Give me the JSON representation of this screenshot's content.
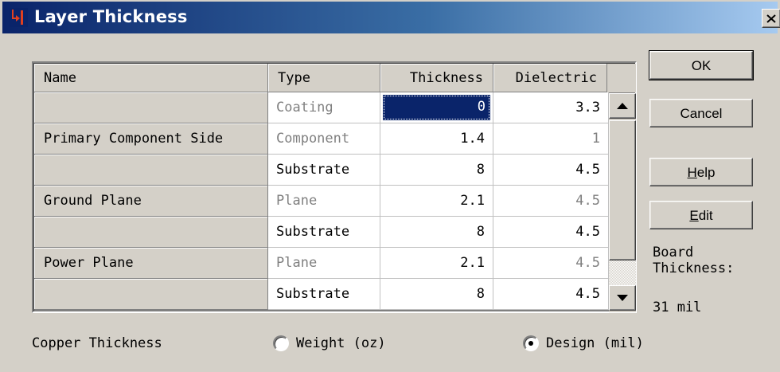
{
  "window": {
    "title": "Layer Thickness"
  },
  "grid": {
    "columns": [
      "Name",
      "Type",
      "Thickness",
      "Dielectric"
    ],
    "rows": [
      {
        "name": "",
        "type": "Coating",
        "thickness": "0",
        "dielectric": "3.3"
      },
      {
        "name": "Primary Component Side",
        "type": "Component",
        "thickness": "1.4",
        "dielectric": "1"
      },
      {
        "name": "",
        "type": "Substrate",
        "thickness": "8",
        "dielectric": "4.5"
      },
      {
        "name": "Ground Plane",
        "type": "Plane",
        "thickness": "2.1",
        "dielectric": "4.5"
      },
      {
        "name": "",
        "type": "Substrate",
        "thickness": "8",
        "dielectric": "4.5"
      },
      {
        "name": "Power Plane",
        "type": "Plane",
        "thickness": "2.1",
        "dielectric": "4.5"
      },
      {
        "name": "",
        "type": "Substrate",
        "thickness": "8",
        "dielectric": "4.5"
      }
    ]
  },
  "buttons": {
    "ok": "OK",
    "cancel": "Cancel",
    "help": {
      "underline": "H",
      "rest": "elp"
    },
    "edit": {
      "underline": "E",
      "rest": "dit"
    }
  },
  "board": {
    "label_line1": "Board",
    "label_line2": "Thickness:",
    "value": "31 mil"
  },
  "copper": {
    "label": "Copper Thickness",
    "options": [
      {
        "label": "Weight (oz)",
        "selected": false
      },
      {
        "label": "Design (mil)",
        "selected": true
      }
    ]
  },
  "colors": {
    "selection": "#0a246a",
    "title_start": "#0a246a",
    "title_end": "#a6caf0",
    "face": "#d4d0c8"
  },
  "icons": {
    "app": "layer-stack-icon",
    "close": "close-icon",
    "scroll_up": "arrow-up-icon",
    "scroll_down": "arrow-down-icon"
  }
}
